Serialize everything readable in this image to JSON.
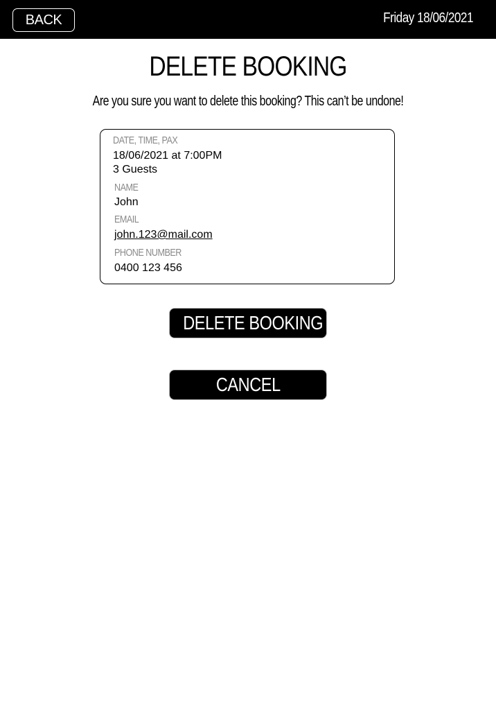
{
  "header": {
    "back_label": "BACK",
    "date": "Friday 18/06/2021"
  },
  "page": {
    "title": "DELETE BOOKING",
    "subtitle": "Are you sure you want to delete this booking? This can’t be undone!"
  },
  "booking": {
    "datetime_label": "DATE, TIME, PAX",
    "datetime_value": "18/06/2021 at 7:00PM",
    "guests_value": "3 Guests",
    "name_label": "NAME",
    "name_value": "John",
    "email_label": "EMAIL",
    "email_value": "john.123@mail.com",
    "phone_label": "PHONE NUMBER",
    "phone_value": "0400 123 456"
  },
  "actions": {
    "delete_label": "DELETE BOOKING",
    "cancel_label": "CANCEL"
  },
  "colors": {
    "header_bg": "#000000",
    "label_gray": "#8a8a8a",
    "button_bg": "#000000"
  }
}
